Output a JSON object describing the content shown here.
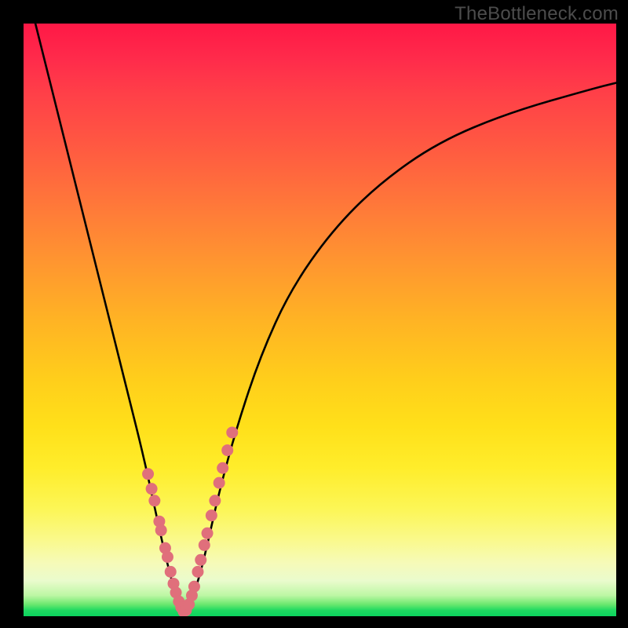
{
  "watermark": "TheBottleneck.com",
  "chart_data": {
    "type": "line",
    "title": "",
    "xlabel": "",
    "ylabel": "",
    "xlim": [
      0,
      100
    ],
    "ylim": [
      0,
      100
    ],
    "grid": false,
    "background_gradient": [
      "#ff1846",
      "#ffce1b",
      "#0bd45e"
    ],
    "series": [
      {
        "name": "curve-left",
        "color": "#000000",
        "x": [
          2,
          4,
          6,
          8,
          10,
          12,
          14,
          16,
          18,
          20,
          22,
          23.5,
          25,
          26,
          27
        ],
        "y": [
          100,
          92,
          84,
          76,
          68,
          60,
          52,
          44,
          36,
          28,
          19,
          12,
          6,
          2.5,
          0.5
        ]
      },
      {
        "name": "curve-right",
        "color": "#000000",
        "x": [
          27,
          28,
          29.5,
          31,
          33,
          36,
          40,
          45,
          52,
          60,
          70,
          82,
          96,
          100
        ],
        "y": [
          0.5,
          2,
          6,
          12,
          21,
          32,
          44,
          55,
          65,
          73,
          80,
          85,
          89,
          90
        ]
      },
      {
        "name": "beads-left",
        "type": "scatter",
        "color": "#e06f7b",
        "x": [
          21.0,
          21.6,
          22.1,
          22.9,
          23.2,
          23.9,
          24.3,
          24.8,
          25.3,
          25.7,
          26.2,
          26.6,
          27.0
        ],
        "y": [
          24.0,
          21.5,
          19.5,
          16.0,
          14.5,
          11.5,
          10.0,
          7.5,
          5.5,
          4.0,
          2.5,
          1.5,
          0.8
        ]
      },
      {
        "name": "beads-right",
        "type": "scatter",
        "color": "#e06f7b",
        "x": [
          27.4,
          27.9,
          28.4,
          28.8,
          29.4,
          29.9,
          30.5,
          31.0,
          31.7,
          32.3,
          33.0,
          33.6,
          34.4,
          35.2
        ],
        "y": [
          1.0,
          2.0,
          3.5,
          5.0,
          7.5,
          9.5,
          12.0,
          14.0,
          17.0,
          19.5,
          22.5,
          25.0,
          28.0,
          31.0
        ]
      }
    ],
    "notes": "V-shaped bottleneck curve over vertical red-yellow-green gradient; minimum at x≈27, y≈0. Axes are not labeled in the image; values are estimated as percent of plot area."
  }
}
